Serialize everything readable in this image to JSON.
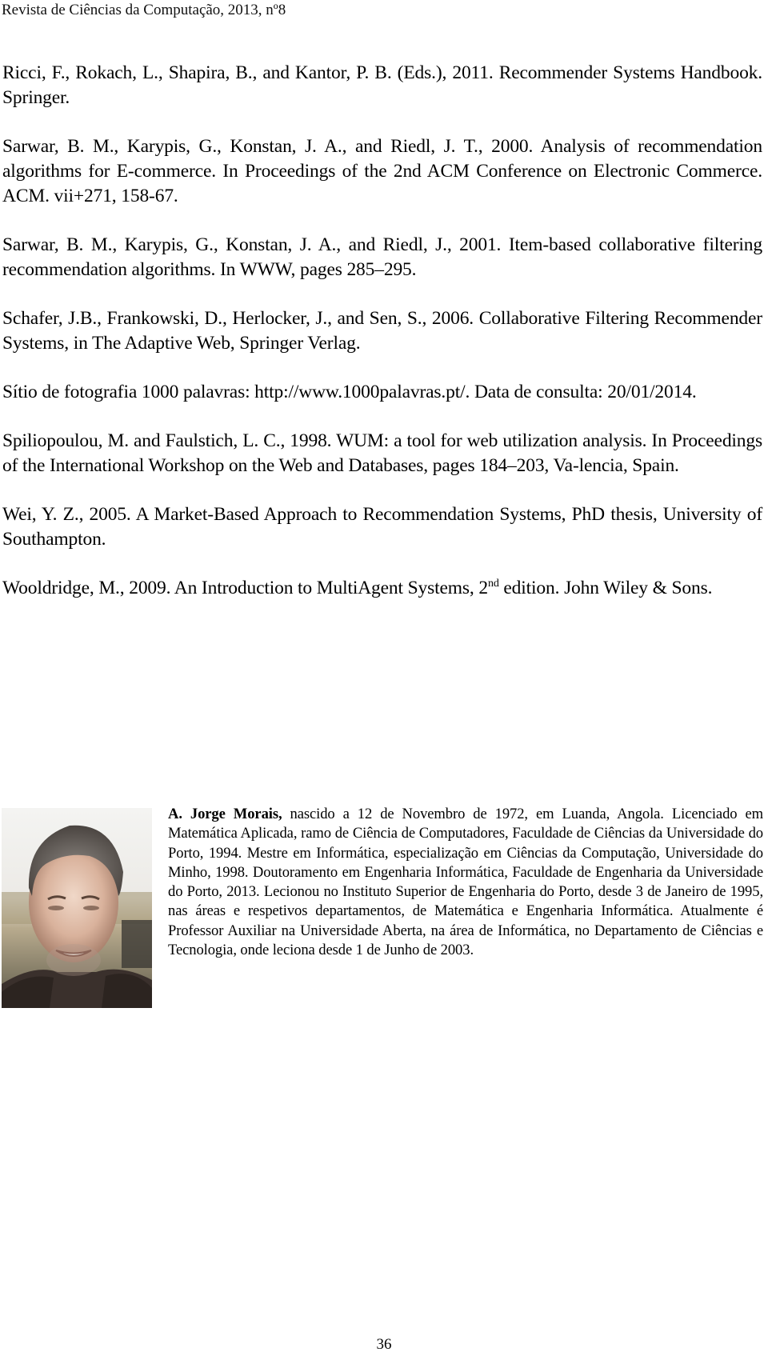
{
  "header": {
    "journal": "Revista de Ciências da Computação, 2013, nº8"
  },
  "references": [
    {
      "text": "Ricci, F., Rokach, L., Shapira, B., and Kantor, P. B. (Eds.), 2011. Recommender Systems Handbook. Springer."
    },
    {
      "text": "Sarwar, B. M., Karypis, G., Konstan, J. A., and Riedl, J. T., 2000. Analysis of recommendation algorithms for E-commerce. In Proceedings of the 2nd ACM Conference on Electronic Commerce. ACM. vii+271, 158-67."
    },
    {
      "text": "Sarwar, B. M., Karypis, G., Konstan, J. A., and Riedl, J., 2001. Item-based collaborative filtering recommendation algorithms. In WWW, pages 285–295."
    },
    {
      "text": "Schafer, J.B., Frankowski, D., Herlocker, J., and Sen, S., 2006. Collaborative Filtering Recommender Systems, in The Adaptive Web, Springer Verlag."
    },
    {
      "text": "Sítio de fotografia 1000 palavras: http://www.1000palavras.pt/. Data de consulta: 20/01/2014."
    },
    {
      "text": "Spiliopoulou, M. and Faulstich, L. C., 1998. WUM: a tool for web utilization analysis. In Proceedings of the International Workshop on the Web and Databases, pages 184–203, Va-lencia, Spain."
    },
    {
      "text": "Wei, Y. Z., 2005. A Market-Based Approach to Recommendation Systems, PhD thesis, University of Southampton."
    },
    {
      "before": "Wooldridge, M., 2009. An Introduction to MultiAgent Systems, 2",
      "sup": "nd",
      "after": " edition. John Wiley & Sons."
    }
  ],
  "author": {
    "photo_alt": "Author portrait photo",
    "name": "A. Jorge Morais,",
    "bio": " nascido a 12 de Novembro de 1972, em Luanda, Angola. Licenciado em Matemática Aplicada, ramo de Ciência de Computadores, Faculdade de Ciências da Universidade do Porto, 1994. Mestre em Informática, especialização em Ciências da Computação, Universidade do Minho, 1998. Doutoramento em Engenharia Informática, Faculdade de Engenharia da Universidade do Porto, 2013. Lecionou no Instituto Superior de Engenharia do Porto, desde 3 de Janeiro de 1995, nas áreas e respetivos departamentos, de Matemática e Engenharia Informática. Atualmente é Professor Auxiliar na Universidade Aberta, na área de Informática, no Departamento de Ciências e Tecnologia, onde leciona desde 1 de Junho de 2003."
  },
  "footer": {
    "page_number": "36"
  }
}
